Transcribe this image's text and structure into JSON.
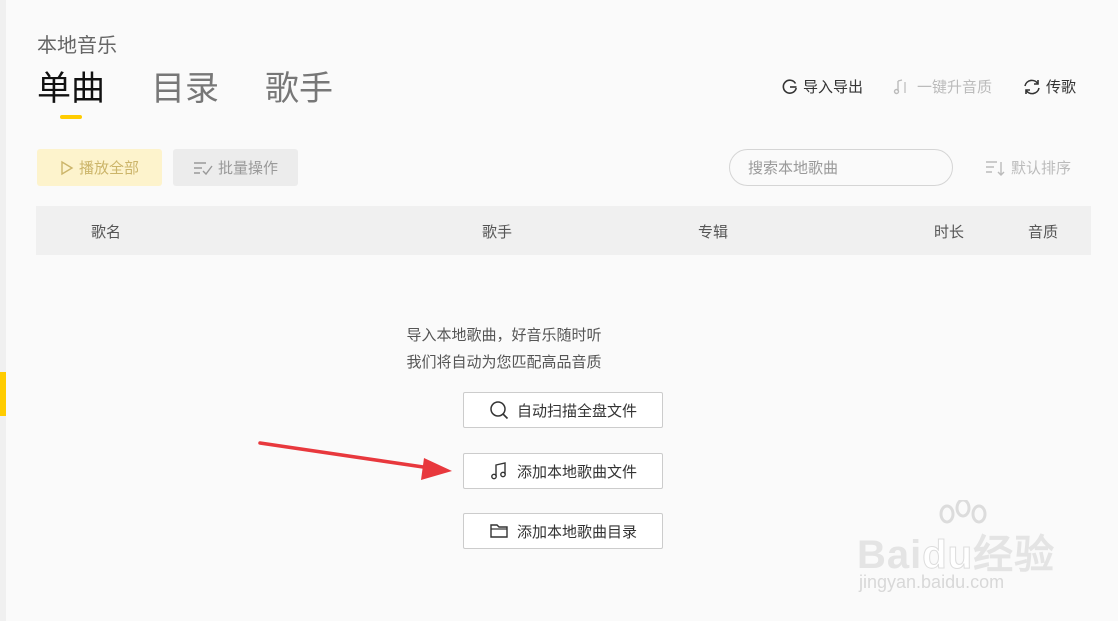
{
  "page": {
    "title": "本地音乐"
  },
  "tabs": [
    {
      "label": "单曲",
      "active": true
    },
    {
      "label": "目录",
      "active": false
    },
    {
      "label": "歌手",
      "active": false
    }
  ],
  "top_actions": [
    {
      "label": "导入导出",
      "icon": "import-export-icon",
      "disabled": false
    },
    {
      "label": "一键升音质",
      "icon": "music-note-icon",
      "disabled": true
    },
    {
      "label": "传歌",
      "icon": "sync-icon",
      "disabled": false
    }
  ],
  "toolbar": {
    "play_all_label": "播放全部",
    "batch_label": "批量操作",
    "search_placeholder": "搜索本地歌曲",
    "sort_label": "默认排序"
  },
  "table": {
    "columns": [
      "歌名",
      "歌手",
      "专辑",
      "时长",
      "音质"
    ]
  },
  "empty_state": {
    "line1": "导入本地歌曲，好音乐随时听",
    "line2": "我们将自动为您匹配高品音质",
    "buttons": [
      {
        "label": "自动扫描全盘文件",
        "icon": "search-icon"
      },
      {
        "label": "添加本地歌曲文件",
        "icon": "music-note-icon"
      },
      {
        "label": "添加本地歌曲目录",
        "icon": "folder-icon"
      }
    ]
  },
  "watermark": {
    "brand_a": "Bai",
    "brand_b": "du",
    "brand_c": "经验",
    "url": "jingyan.baidu.com"
  },
  "colors": {
    "accent": "#ffcc00",
    "arrow": "#e8383d"
  }
}
